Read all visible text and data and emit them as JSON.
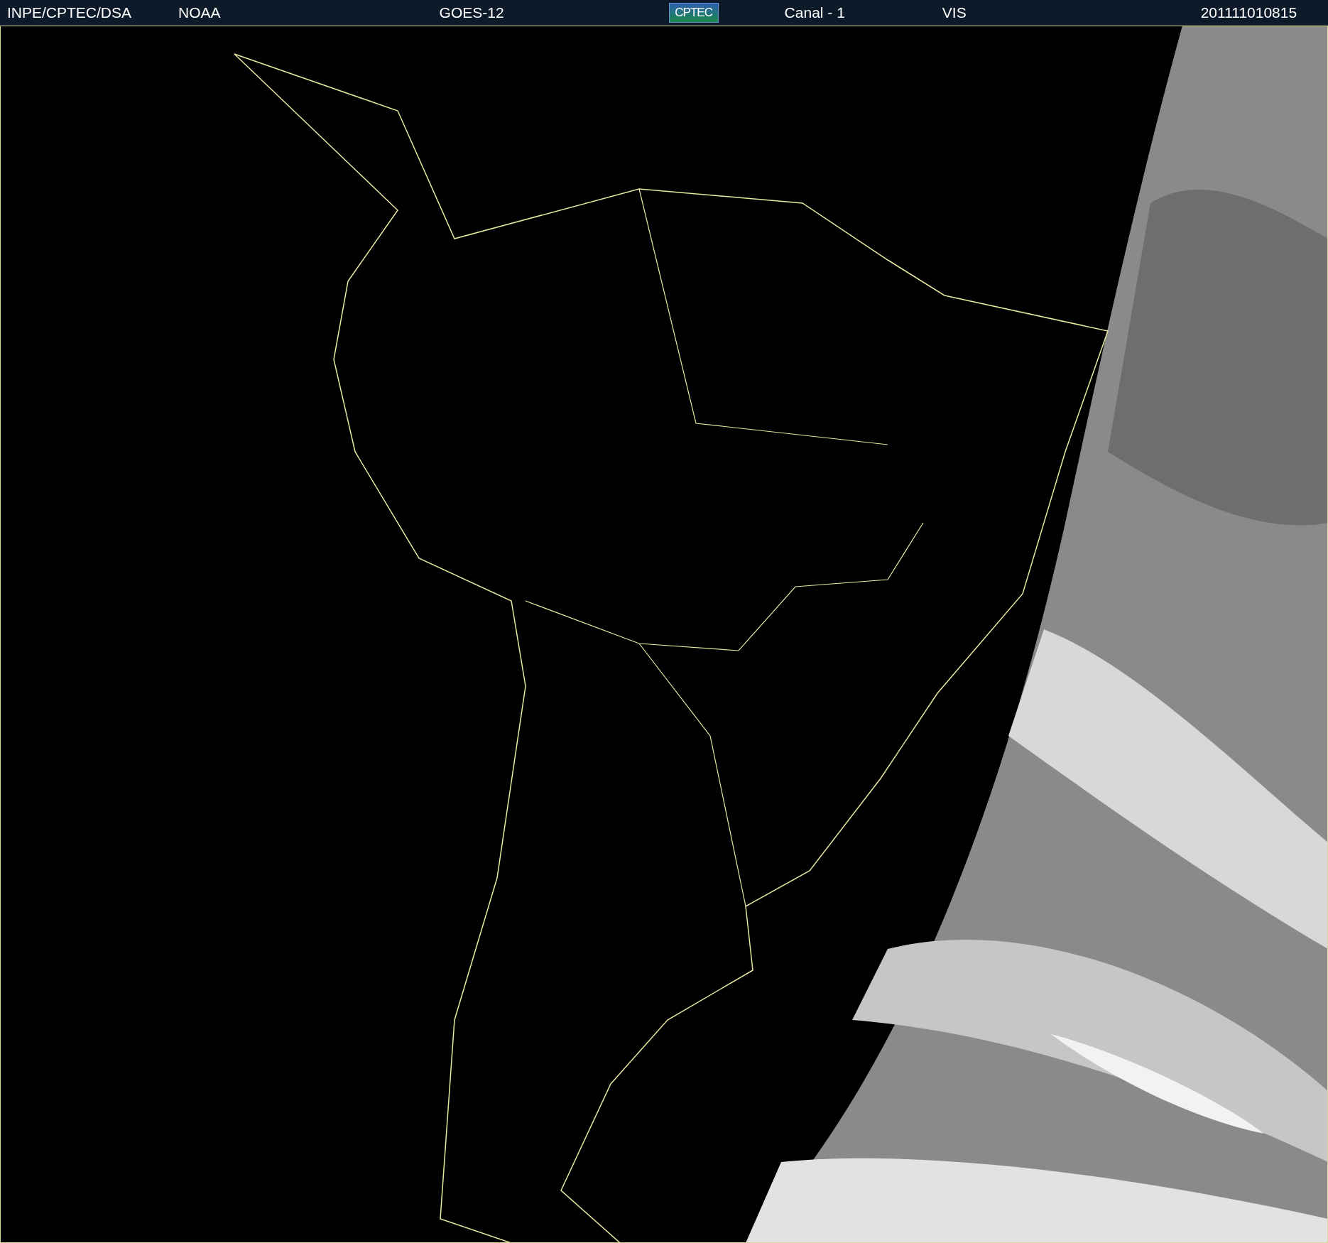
{
  "header": {
    "items": [
      {
        "kind": "text",
        "text": "INPE/CPTEC/DSA"
      },
      {
        "kind": "text",
        "text": "NOAA"
      },
      {
        "kind": "text",
        "text": "GOES-12"
      },
      {
        "kind": "logo",
        "text": "CPTEC"
      },
      {
        "kind": "text",
        "text": "Canal - 1"
      },
      {
        "kind": "text",
        "text": "VIS"
      },
      {
        "kind": "text",
        "text": "201111010815"
      }
    ]
  }
}
